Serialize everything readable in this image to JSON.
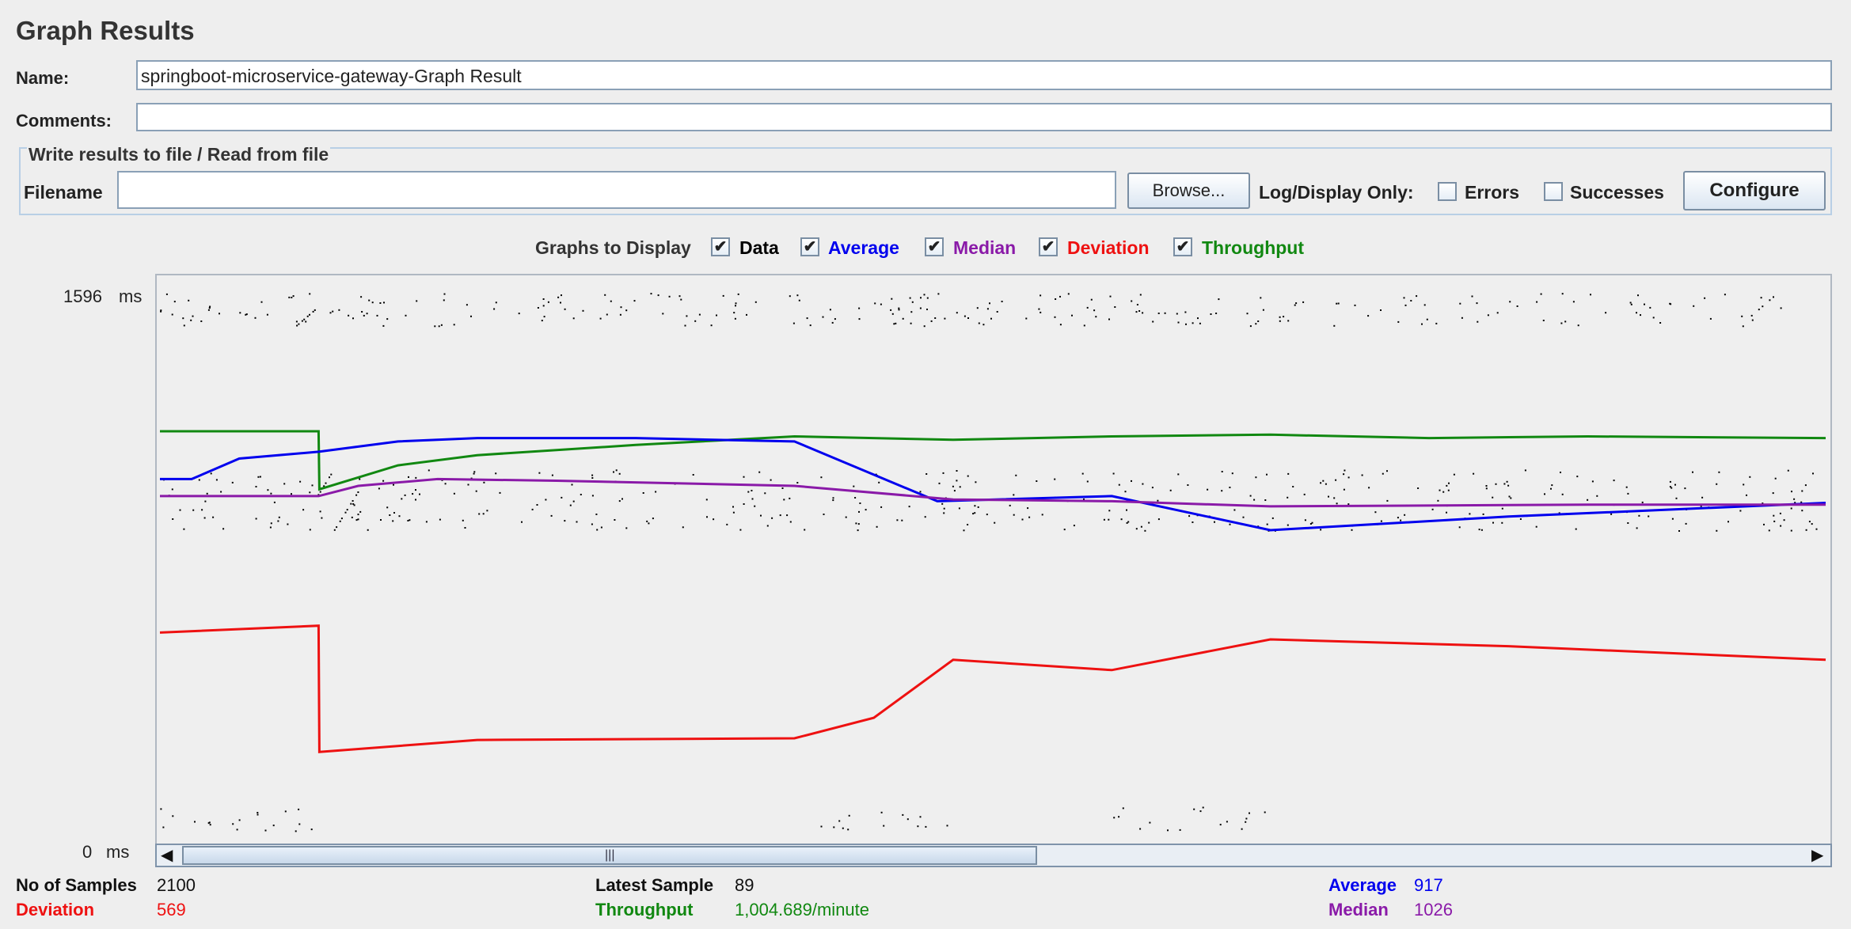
{
  "panel": {
    "title": "Graph Results",
    "name_label": "Name:",
    "name_value": "springboot-microservice-gateway-Graph Result",
    "comments_label": "Comments:",
    "comments_value": "",
    "file_group_title": "Write results to file / Read from file",
    "filename_label": "Filename",
    "filename_value": "",
    "browse_label": "Browse...",
    "log_display_label": "Log/Display Only:",
    "errors_label": "Errors",
    "successes_label": "Successes",
    "configure_label": "Configure"
  },
  "graphs_to_display": {
    "label": "Graphs to Display",
    "options": [
      {
        "label": "Data",
        "checked": true,
        "color": "#000000"
      },
      {
        "label": "Average",
        "checked": true,
        "color": "#0000ee"
      },
      {
        "label": "Median",
        "checked": true,
        "color": "#8a1aa8"
      },
      {
        "label": "Deviation",
        "checked": true,
        "color": "#ee1111"
      },
      {
        "label": "Throughput",
        "checked": true,
        "color": "#118811"
      }
    ]
  },
  "axis": {
    "max_value": "1596",
    "max_unit": "ms",
    "min_value": "0",
    "min_unit": "ms"
  },
  "stats": {
    "samples_label": "No of Samples",
    "samples_value": "2100",
    "deviation_label": "Deviation",
    "deviation_value": "569",
    "latest_label": "Latest Sample",
    "latest_value": "89",
    "throughput_label": "Throughput",
    "throughput_value": "1,004.689/minute",
    "average_label": "Average",
    "average_value": "917",
    "median_label": "Median",
    "median_value": "1026"
  },
  "colors": {
    "data": "#000000",
    "average": "#0000ee",
    "median": "#8a1aa8",
    "deviation": "#ee1111",
    "throughput": "#118811"
  },
  "chart_data": {
    "type": "line",
    "ylim": [
      0,
      1596
    ],
    "y_unit": "ms",
    "x_unit": "sample index (approx.)",
    "series": [
      {
        "key": "throughput",
        "points": [
          [
            0,
            1190
          ],
          [
            200,
            1190
          ],
          [
            201,
            1020
          ],
          [
            300,
            1090
          ],
          [
            400,
            1120
          ],
          [
            600,
            1150
          ],
          [
            800,
            1175
          ],
          [
            1000,
            1165
          ],
          [
            1200,
            1175
          ],
          [
            1400,
            1180
          ],
          [
            1600,
            1170
          ],
          [
            1800,
            1175
          ],
          [
            2100,
            1170
          ]
        ]
      },
      {
        "key": "average",
        "points": [
          [
            0,
            1050
          ],
          [
            40,
            1050
          ],
          [
            100,
            1110
          ],
          [
            200,
            1130
          ],
          [
            300,
            1160
          ],
          [
            400,
            1170
          ],
          [
            600,
            1170
          ],
          [
            800,
            1160
          ],
          [
            980,
            985
          ],
          [
            1200,
            1000
          ],
          [
            1400,
            900
          ],
          [
            1700,
            940
          ],
          [
            2100,
            980
          ]
        ]
      },
      {
        "key": "median",
        "points": [
          [
            0,
            1000
          ],
          [
            200,
            1000
          ],
          [
            250,
            1030
          ],
          [
            350,
            1050
          ],
          [
            500,
            1045
          ],
          [
            800,
            1030
          ],
          [
            1000,
            990
          ],
          [
            1200,
            985
          ],
          [
            1400,
            970
          ],
          [
            1800,
            975
          ],
          [
            2100,
            975
          ]
        ]
      },
      {
        "key": "deviation",
        "points": [
          [
            0,
            600
          ],
          [
            200,
            620
          ],
          [
            201,
            250
          ],
          [
            400,
            285
          ],
          [
            800,
            290
          ],
          [
            900,
            350
          ],
          [
            1000,
            520
          ],
          [
            1200,
            490
          ],
          [
            1400,
            580
          ],
          [
            1700,
            560
          ],
          [
            2100,
            520
          ]
        ]
      }
    ]
  }
}
